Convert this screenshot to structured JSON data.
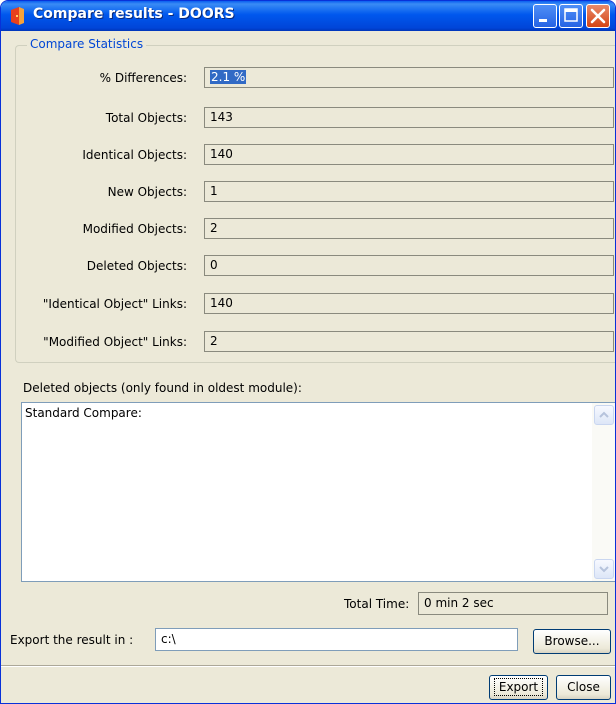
{
  "window": {
    "title": "Compare results - DOORS",
    "icons": {
      "app": "doors-app-icon",
      "minimize": "minimize-icon",
      "maximize": "maximize-icon",
      "close": "close-icon"
    },
    "colors": {
      "titlebar": "#0058ee",
      "dialog_bg": "#ece9d8",
      "legend_text": "#0046d5",
      "selection": "#316ac5"
    }
  },
  "stats": {
    "legend": "Compare Statistics",
    "rows": [
      {
        "label": "% Differences:",
        "value": "2.1 %"
      },
      {
        "label": "Total Objects:",
        "value": "143"
      },
      {
        "label": "Identical Objects:",
        "value": "140"
      },
      {
        "label": "New Objects:",
        "value": "1"
      },
      {
        "label": "Modified Objects:",
        "value": "2"
      },
      {
        "label": "Deleted Objects:",
        "value": "0"
      },
      {
        "label": "\"Identical Object\" Links:",
        "value": "140"
      },
      {
        "label": "\"Modified Object\" Links:",
        "value": "2"
      }
    ]
  },
  "deleted": {
    "label": "Deleted objects (only found in oldest module):",
    "text": "Standard Compare:"
  },
  "total_time": {
    "label": "Total Time:",
    "value": "0 min 2 sec"
  },
  "export": {
    "label": "Export the result in :",
    "path": "c:\\",
    "browse_label": "Browse...",
    "export_label": "Export",
    "close_label": "Close"
  }
}
